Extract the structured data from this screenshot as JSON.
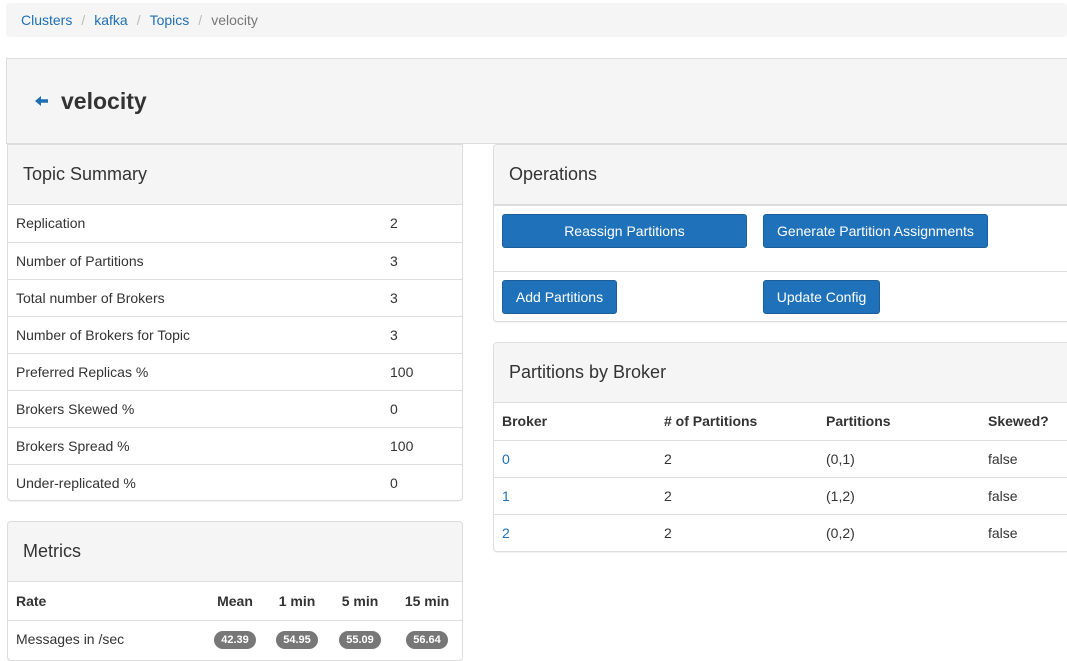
{
  "breadcrumb": {
    "items": [
      {
        "label": "Clusters"
      },
      {
        "label": "kafka"
      },
      {
        "label": "Topics"
      }
    ],
    "current": "velocity",
    "separator": "/"
  },
  "header": {
    "title": "velocity",
    "back_icon": "arrow-left-icon"
  },
  "topic_summary": {
    "title": "Topic Summary",
    "rows": [
      {
        "label": "Replication",
        "value": "2"
      },
      {
        "label": "Number of Partitions",
        "value": "3"
      },
      {
        "label": "Total number of Brokers",
        "value": "3"
      },
      {
        "label": "Number of Brokers for Topic",
        "value": "3"
      },
      {
        "label": "Preferred Replicas %",
        "value": "100"
      },
      {
        "label": "Brokers Skewed %",
        "value": "0"
      },
      {
        "label": "Brokers Spread %",
        "value": "100"
      },
      {
        "label": "Under-replicated %",
        "value": "0"
      }
    ]
  },
  "metrics": {
    "title": "Metrics",
    "columns": [
      "Rate",
      "Mean",
      "1 min",
      "5 min",
      "15 min"
    ],
    "rows": [
      {
        "label": "Messages in /sec",
        "mean": "42.39",
        "m1": "54.95",
        "m5": "55.09",
        "m15": "56.64"
      }
    ]
  },
  "operations": {
    "title": "Operations",
    "reassign_label": "Reassign Partitions",
    "generate_label": "Generate Partition Assignments",
    "add_label": "Add Partitions",
    "update_label": "Update Config"
  },
  "partitions_by_broker": {
    "title": "Partitions by Broker",
    "columns": [
      "Broker",
      "# of Partitions",
      "Partitions",
      "Skewed?"
    ],
    "rows": [
      {
        "broker": "0",
        "count": "2",
        "partitions": "(0,1)",
        "skewed": "false"
      },
      {
        "broker": "1",
        "count": "2",
        "partitions": "(1,2)",
        "skewed": "false"
      },
      {
        "broker": "2",
        "count": "2",
        "partitions": "(0,2)",
        "skewed": "false"
      }
    ]
  },
  "colors": {
    "link": "#1f6fb2",
    "primary_button": "#1f72ba",
    "panel_heading_bg": "#f5f5f5",
    "badge_bg": "#777777"
  }
}
